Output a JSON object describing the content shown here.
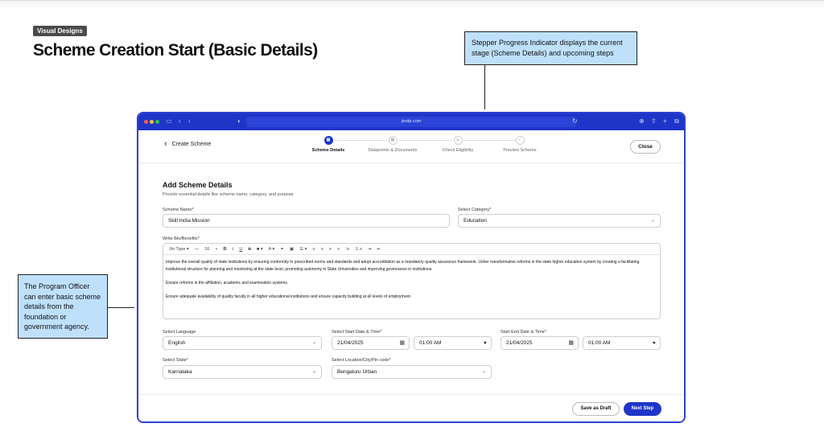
{
  "tag": "Visual Designs",
  "title": "Scheme Creation Start (Basic Details)",
  "callouts": {
    "top": "Stepper Progress Indicator displays the current stage (Scheme Details) and upcoming steps",
    "left": "The Program Officer can enter basic scheme details from the foundation or government agency."
  },
  "browser": {
    "url": "jiostp.com"
  },
  "header": {
    "back_label": "Create Scheme",
    "close_label": "Close",
    "steps": [
      {
        "label": "Scheme Details",
        "active": true
      },
      {
        "label": "Datapoints & Documents",
        "active": false
      },
      {
        "label": "Check Eligibility",
        "active": false
      },
      {
        "label": "Preview Scheme",
        "active": false
      }
    ]
  },
  "form": {
    "title": "Add Scheme Details",
    "subtitle": "Provide essential details like scheme name, category, and purpose",
    "scheme_name_label": "Scheme Name*",
    "scheme_name_value": "Skill India Mission",
    "category_label": "Select Category*",
    "category_value": "Education",
    "bio_label": "Write Bio/Benefits*",
    "toolbar": {
      "font": "Jio Type",
      "size": "16"
    },
    "bio_paragraphs": [
      "Improve the overall quality of state institutions by ensuring conformity to prescribed norms and standards and adopt accreditation as a mandatory quality assurance framework. Usher transformative reforms in the state higher education system by creating a facilitating institutional structure for planning and monitoring at the state level, promoting autonomy in State Universities and improving governance in institutions.",
      "Ensure reforms in the affiliation, academic and examination systems.",
      "Ensure adequate availability of quality faculty in all higher educational institutions and ensure capacity building at all levels of employment."
    ],
    "language_label": "Select Language",
    "language_value": "English",
    "start_label": "Select Start Date & Time*",
    "start_date": "21/04/2025",
    "start_time": "01:00 AM",
    "end_label": "Start End Date & Time*",
    "end_date": "21/04/2025",
    "end_time": "01:00 AM",
    "state_label": "Select State*",
    "state_value": "Karnataka",
    "location_label": "Select Location/City/Pin code*",
    "location_value": "Bengaluru Urban"
  },
  "footer": {
    "draft_label": "Save as Draft",
    "next_label": "Next Step"
  },
  "colors": {
    "accent": "#1e35c8",
    "callout": "#bfe0fb"
  }
}
